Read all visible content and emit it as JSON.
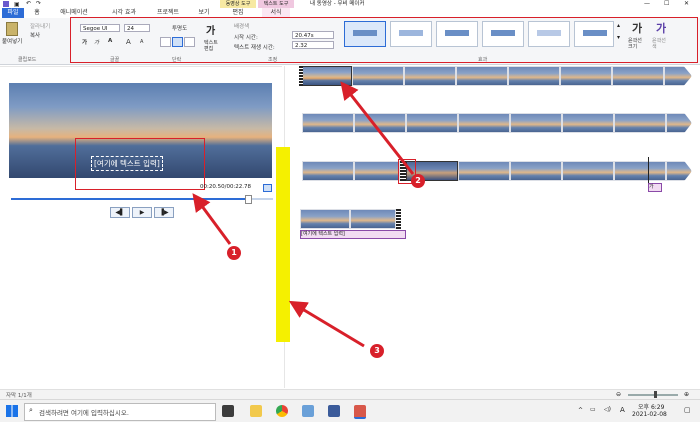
{
  "window": {
    "title": "내 동영상 - 무비 메이커",
    "context_tab_video": "동영상 도구",
    "context_tab_text": "텍스트 도구",
    "controls": [
      "—",
      "☐",
      "✕"
    ]
  },
  "tabs": [
    {
      "label": "파일"
    },
    {
      "label": "홈"
    },
    {
      "label": "애니메이션"
    },
    {
      "label": "시각 효과"
    },
    {
      "label": "프로젝트"
    },
    {
      "label": "보기"
    },
    {
      "label": "편집"
    },
    {
      "label": "서식"
    }
  ],
  "ribbon": {
    "clipboard": {
      "paste": "붙여넣기",
      "cut": "잘라내기",
      "copy": "복사",
      "group": "클립보드"
    },
    "font": {
      "face": "Segoe UI",
      "size": "24",
      "bold": "가",
      "italic": "가",
      "color": "A",
      "grow": "A",
      "shrink": "A",
      "group": "글꼴"
    },
    "paragraph": {
      "transparency": "투명도",
      "group": "단락"
    },
    "adjust": {
      "text_edit": "텍스트\n편집",
      "bg_color": "배경색",
      "start_time_label": "시작 시간:",
      "start_time_value": "20.47s",
      "duration_label": "텍스트 재생 시간:",
      "duration_value": "2.32",
      "group": "조정"
    },
    "effects": {
      "group": "효과",
      "outline_size": "윤곽선\n크기",
      "outline_color": "윤곽선\n색"
    }
  },
  "preview": {
    "overlay_text": "[여기에 텍스트 입력]",
    "timecode": "00:20.50/00:22.78",
    "progress": 0.9
  },
  "storyboard": {
    "caption_1": "[여기에 텍스트 입력]",
    "caption_2": "[여기에 텍스트 입력]"
  },
  "annotations": [
    "1",
    "2",
    "3"
  ],
  "statusbar": {
    "left": "자막 1/1개"
  },
  "taskbar": {
    "search_placeholder": "검색하려면 여기에 입력하십시오.",
    "time": "오후 6:29",
    "date": "2021-02-08",
    "ime": "A"
  },
  "colors": {
    "accent": "#2d6cd6",
    "annotation": "#d8202a",
    "highlight": "#f5f000"
  }
}
